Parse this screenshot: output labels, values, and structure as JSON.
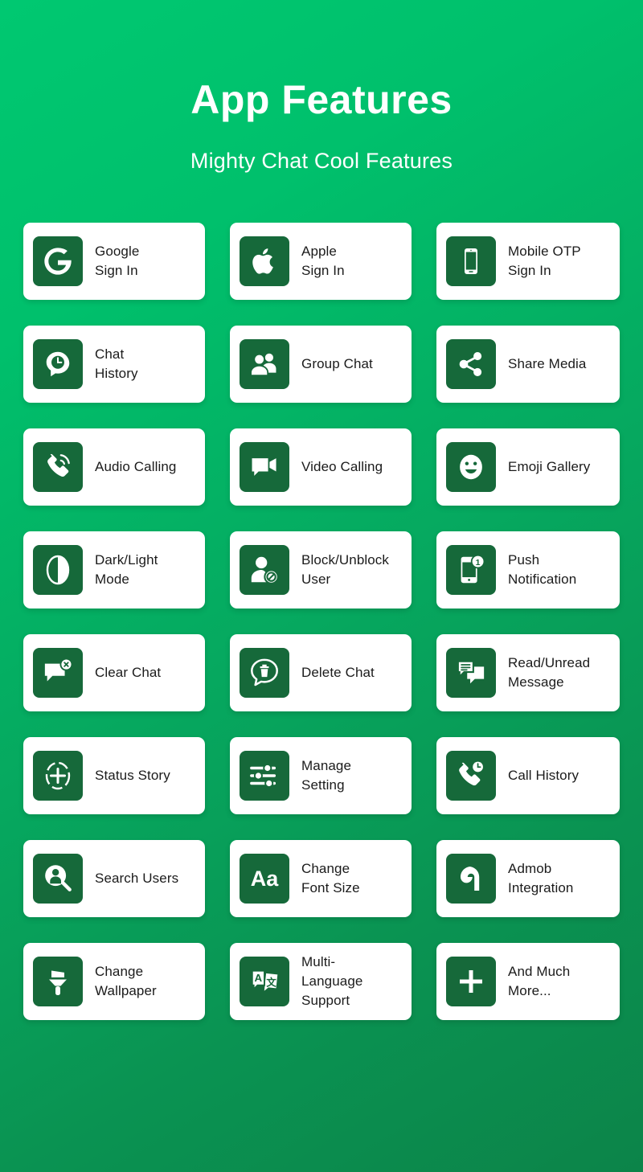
{
  "header": {
    "title": "App Features",
    "subtitle": "Mighty Chat Cool Features"
  },
  "colors": {
    "background_top": "#00C871",
    "background_bottom": "#0C8449",
    "card_background": "#FFFFFF",
    "icon_tile": "#16693A",
    "label_text": "#1B1B1B",
    "header_text": "#FFFFFF"
  },
  "features": [
    [
      {
        "label": "Google\nSign In",
        "icon": "google-icon"
      },
      {
        "label": "Apple\nSign In",
        "icon": "apple-icon"
      },
      {
        "label": "Mobile OTP\nSign In",
        "icon": "mobile-phone-icon"
      }
    ],
    [
      {
        "label": "Chat\nHistory",
        "icon": "chat-history-icon"
      },
      {
        "label": "Group Chat",
        "icon": "group-people-icon"
      },
      {
        "label": "Share Media",
        "icon": "share-nodes-icon"
      }
    ],
    [
      {
        "label": "Audio Calling",
        "icon": "phone-call-icon"
      },
      {
        "label": "Video Calling",
        "icon": "video-camera-icon"
      },
      {
        "label": "Emoji Gallery",
        "icon": "smiley-face-icon"
      }
    ],
    [
      {
        "label": "Dark/Light\nMode",
        "icon": "contrast-circle-icon"
      },
      {
        "label": "Block/Unblock\nUser",
        "icon": "user-block-icon"
      },
      {
        "label": "Push\nNotification",
        "icon": "push-notification-icon"
      }
    ],
    [
      {
        "label": "Clear Chat",
        "icon": "chat-clear-icon"
      },
      {
        "label": "Delete Chat",
        "icon": "chat-trash-icon"
      },
      {
        "label": "Read/Unread\nMessage",
        "icon": "read-message-icon"
      }
    ],
    [
      {
        "label": "Status Story",
        "icon": "status-plus-circle-icon"
      },
      {
        "label": "Manage\nSetting",
        "icon": "sliders-settings-icon"
      },
      {
        "label": "Call History",
        "icon": "call-history-icon"
      }
    ],
    [
      {
        "label": "Search Users",
        "icon": "search-user-icon"
      },
      {
        "label": "Change\nFont Size",
        "icon": "font-size-aa-icon"
      },
      {
        "label": "Admob\nIntegration",
        "icon": "admob-icon"
      }
    ],
    [
      {
        "label": "Change\nWallpaper",
        "icon": "paint-brush-icon"
      },
      {
        "label": "Multi-\nLanguage\nSupport",
        "icon": "translate-icon"
      },
      {
        "label": "And Much\nMore...",
        "icon": "plus-icon"
      }
    ]
  ]
}
